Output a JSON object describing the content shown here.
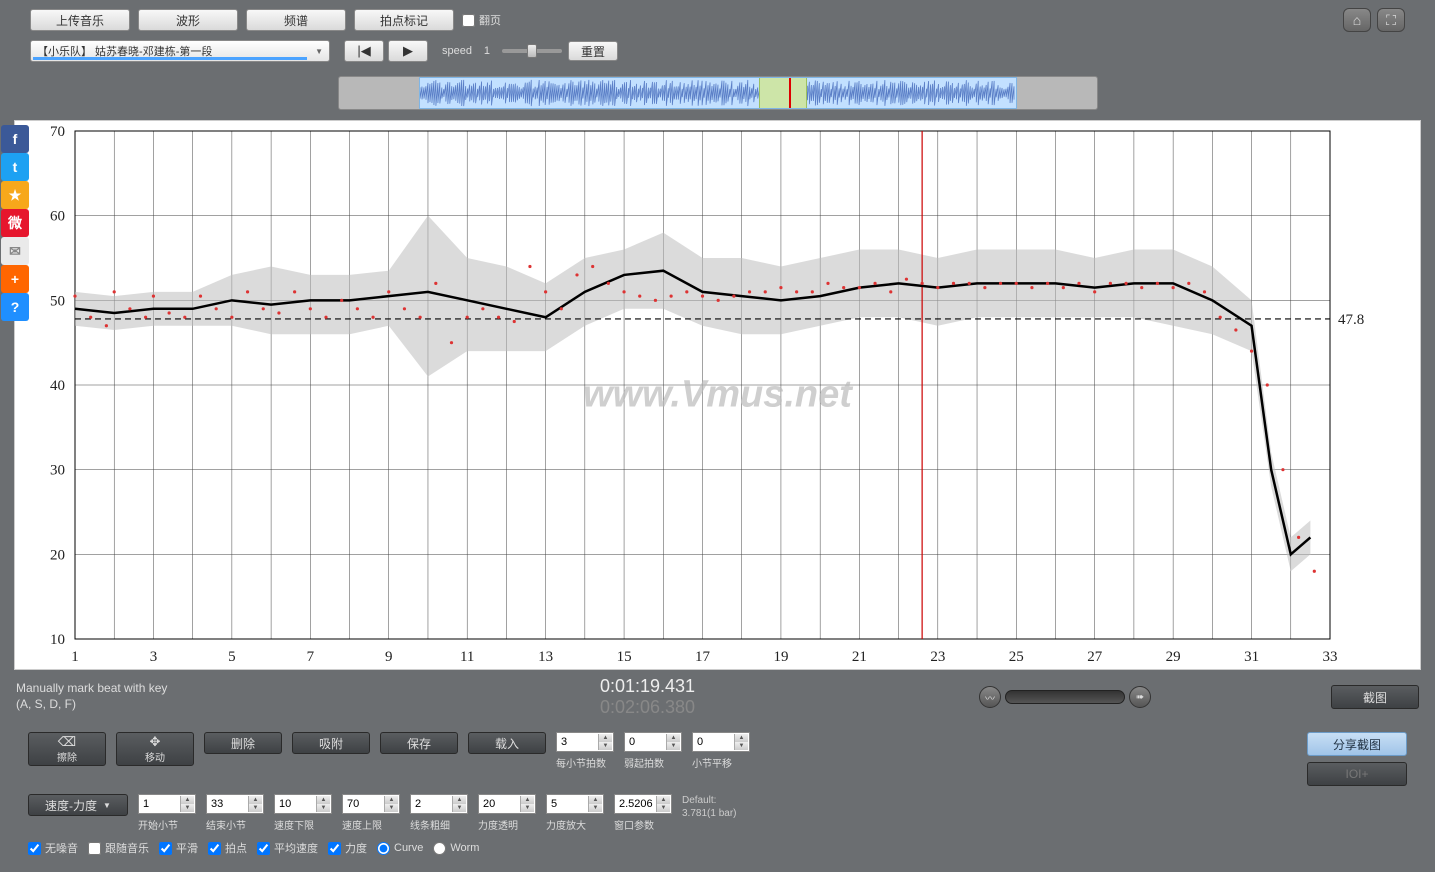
{
  "toolbar": {
    "upload": "上传音乐",
    "wave": "波形",
    "spectrum": "频谱",
    "beat": "拍点标记",
    "page": "翻页"
  },
  "track": {
    "title": "【小乐队】 姑苏春晓-邓建栋-第一段"
  },
  "speed": {
    "label": "speed",
    "value": "1",
    "reset": "重置"
  },
  "status": {
    "hint1": "Manually mark beat with key",
    "hint2": "(A, S, D, F)",
    "cur": "0:01:19.431",
    "dur": "0:02:06.380",
    "screenshot": "截图"
  },
  "tools": {
    "erase": "擦除",
    "move": "移动",
    "delete": "删除",
    "snap": "吸附",
    "save": "保存",
    "load": "载入"
  },
  "spinners": {
    "beats_per_bar": {
      "v": "3",
      "l": "每小节拍数"
    },
    "anacrusis": {
      "v": "0",
      "l": "弱起拍数"
    },
    "bar_shift": {
      "v": "0",
      "l": "小节平移"
    },
    "start_bar": {
      "v": "1",
      "l": "开始小节"
    },
    "end_bar": {
      "v": "33",
      "l": "结束小节"
    },
    "speed_lo": {
      "v": "10",
      "l": "速度下限"
    },
    "speed_hi": {
      "v": "70",
      "l": "速度上限"
    },
    "line_w": {
      "v": "2",
      "l": "线条粗细"
    },
    "dyn_alpha": {
      "v": "20",
      "l": "力度透明"
    },
    "dyn_scale": {
      "v": "5",
      "l": "力度放大"
    },
    "window": {
      "v": "2.5206",
      "l": "窗口参数"
    }
  },
  "defaults": {
    "label": "Default:",
    "value": "3.781(1 bar)"
  },
  "mode_select": "速度-力度",
  "share": "分享截图",
  "ioi": "IOI+",
  "checks": {
    "nojitter": "无噪音",
    "follow": "跟随音乐",
    "smooth": "平滑",
    "beats": "拍点",
    "avgspeed": "平均速度",
    "dynamics": "力度",
    "curve": "Curve",
    "worm": "Worm"
  },
  "watermark": "www.Vmus.net",
  "chart_data": {
    "type": "line",
    "xlabel": "",
    "ylabel": "",
    "xlim": [
      1,
      33
    ],
    "ylim": [
      10,
      70
    ],
    "x_ticks": [
      1,
      3,
      5,
      7,
      9,
      11,
      13,
      15,
      17,
      19,
      21,
      23,
      25,
      27,
      29,
      31,
      33
    ],
    "y_ticks": [
      10,
      20,
      30,
      40,
      50,
      60,
      70
    ],
    "mean_line": 47.8,
    "cursor_x": 22.6,
    "series": [
      {
        "name": "tempo",
        "x": [
          1,
          2,
          3,
          4,
          5,
          6,
          7,
          8,
          9,
          10,
          11,
          12,
          13,
          14,
          15,
          16,
          17,
          18,
          19,
          20,
          21,
          22,
          23,
          24,
          25,
          26,
          27,
          28,
          29,
          30,
          31,
          31.5,
          32,
          32.5
        ],
        "y": [
          49,
          48.5,
          49,
          49,
          50,
          49.5,
          50,
          50,
          50.5,
          51,
          50,
          49,
          48,
          51,
          53,
          53.5,
          51,
          50.5,
          50,
          50.5,
          51.5,
          52,
          51.5,
          52,
          52,
          52,
          51.5,
          52,
          52,
          50,
          47,
          30,
          20,
          22
        ]
      }
    ],
    "band": {
      "x": [
        1,
        2,
        3,
        4,
        5,
        6,
        7,
        8,
        9,
        10,
        11,
        12,
        13,
        14,
        15,
        16,
        17,
        18,
        19,
        20,
        21,
        22,
        23,
        24,
        25,
        26,
        27,
        28,
        29,
        30,
        31,
        31.5,
        32,
        32.5
      ],
      "lo": [
        47,
        46.5,
        47,
        47,
        47,
        46,
        46,
        46,
        47,
        41,
        44,
        44,
        44,
        47,
        49,
        49,
        47,
        46,
        46,
        47,
        48,
        48,
        47,
        48,
        48,
        48,
        48,
        48,
        47,
        46,
        44,
        28,
        18,
        20
      ],
      "hi": [
        51,
        50.5,
        51,
        51,
        53,
        54,
        53,
        53,
        53.5,
        60,
        55,
        54,
        52,
        55,
        56,
        58,
        55,
        55,
        54,
        55,
        56,
        56,
        55,
        56,
        56,
        56,
        55,
        56,
        56,
        54,
        50,
        32,
        22,
        24
      ]
    },
    "points": {
      "x": [
        1,
        1.4,
        1.8,
        2,
        2.4,
        2.8,
        3,
        3.4,
        3.8,
        4.2,
        4.6,
        5,
        5.4,
        5.8,
        6.2,
        6.6,
        7,
        7.4,
        7.8,
        8.2,
        8.6,
        9,
        9.4,
        9.8,
        10.2,
        10.6,
        11,
        11.4,
        11.8,
        12.2,
        12.6,
        13,
        13.4,
        13.8,
        14.2,
        14.6,
        15,
        15.4,
        15.8,
        16.2,
        16.6,
        17,
        17.4,
        17.8,
        18.2,
        18.6,
        19,
        19.4,
        19.8,
        20.2,
        20.6,
        21,
        21.4,
        21.8,
        22.2,
        22.6,
        23,
        23.4,
        23.8,
        24.2,
        24.6,
        25,
        25.4,
        25.8,
        26.2,
        26.6,
        27,
        27.4,
        27.8,
        28.2,
        28.6,
        29,
        29.4,
        29.8,
        30.2,
        30.6,
        31,
        31.4,
        31.8,
        32.2,
        32.6
      ],
      "y": [
        50.5,
        48,
        47,
        51,
        49,
        48,
        50.5,
        48.5,
        48,
        50.5,
        49,
        48,
        51,
        49,
        48.5,
        51,
        49,
        48,
        50,
        49,
        48,
        51,
        49,
        48,
        52,
        45,
        48,
        49,
        48,
        47.5,
        54,
        51,
        49,
        53,
        54,
        52,
        51,
        50.5,
        50,
        50.5,
        51,
        50.5,
        50,
        50.5,
        51,
        51,
        51.5,
        51,
        51,
        52,
        51.5,
        51.5,
        52,
        51,
        52.5,
        52,
        51.5,
        52,
        52,
        51.5,
        52,
        52,
        51.5,
        52,
        51.5,
        52,
        51,
        52,
        52,
        51.5,
        52,
        51.5,
        52,
        51,
        48,
        46.5,
        44,
        40,
        30,
        22,
        18
      ]
    }
  }
}
